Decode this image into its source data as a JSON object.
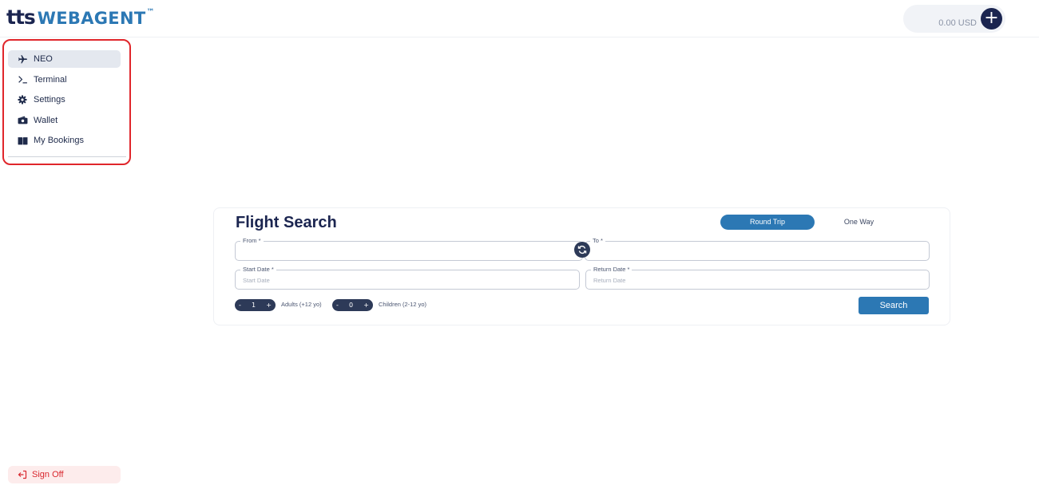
{
  "brand": {
    "tts": "tts",
    "name": "WEBAGENT",
    "tm": "™"
  },
  "header": {
    "balance": "0.00 USD",
    "add_icon": "plus-circle-icon"
  },
  "sidebar": {
    "items": [
      {
        "label": "NEO",
        "icon": "airplane-icon",
        "active": true
      },
      {
        "label": "Terminal",
        "icon": "terminal-icon"
      },
      {
        "label": "Settings",
        "icon": "gear-icon"
      },
      {
        "label": "Wallet",
        "icon": "wallet-icon"
      },
      {
        "label": "My Bookings",
        "icon": "book-icon"
      }
    ],
    "sign_off": "Sign Off"
  },
  "flight_search": {
    "title": "Flight Search",
    "trip_types": {
      "round_trip": "Round Trip",
      "one_way": "One Way",
      "selected": "Round Trip"
    },
    "from": {
      "label": "From *",
      "value": ""
    },
    "to": {
      "label": "To *",
      "value": ""
    },
    "start_date": {
      "label": "Start Date *",
      "placeholder": "Start Date"
    },
    "return_date": {
      "label": "Return Date *",
      "placeholder": "Return Date"
    },
    "adults": {
      "minus": "-",
      "value": "1",
      "plus": "+",
      "label": "Adults (+12 yo)"
    },
    "children": {
      "minus": "-",
      "value": "0",
      "plus": "+",
      "label": "Children (2-12 yo)"
    },
    "search_label": "Search"
  },
  "colors": {
    "primary": "#2c78b4",
    "navy": "#1b2550",
    "highlight": "#e0262b",
    "danger": "#d9282f"
  }
}
